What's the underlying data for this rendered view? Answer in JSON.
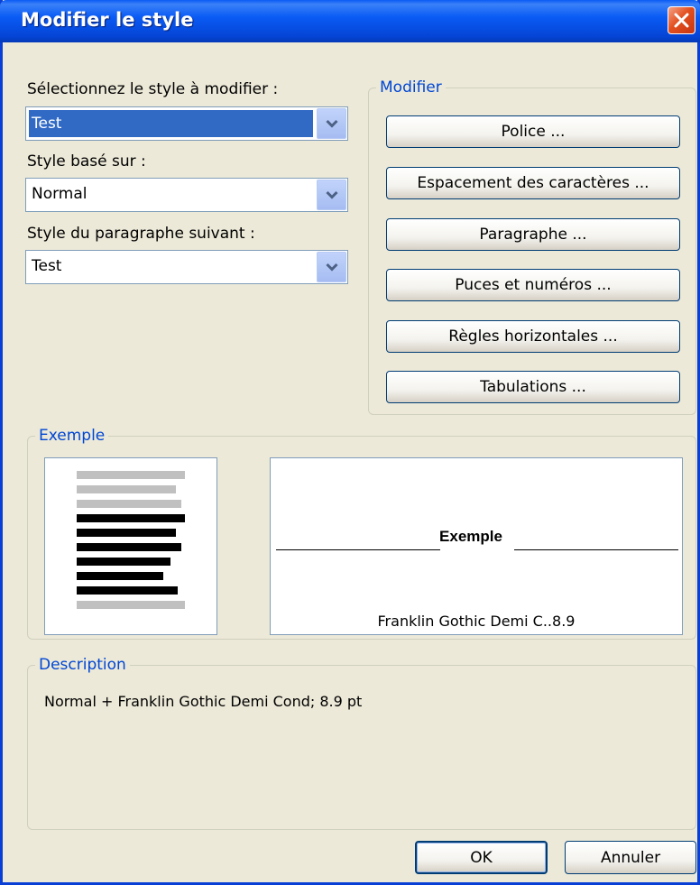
{
  "window": {
    "title": "Modifier le style"
  },
  "left": {
    "style_label": "Sélectionnez le style à modifier :",
    "style_value": "Test",
    "based_on_label": "Style basé sur :",
    "based_on_value": "Normal",
    "next_label": "Style du paragraphe suivant :",
    "next_value": "Test"
  },
  "modify": {
    "legend": "Modifier",
    "buttons": [
      "Police ...",
      "Espacement des caractères ...",
      "Paragraphe ...",
      "Puces et numéros ...",
      "Règles horizontales ...",
      "Tabulations ..."
    ]
  },
  "example": {
    "legend": "Exemple",
    "sample_text": "Exemple",
    "font_caption": "Franklin Gothic Demi C..8.9"
  },
  "description": {
    "legend": "Description",
    "text": "Normal +  Franklin Gothic Demi Cond; 8.9 pt"
  },
  "footer": {
    "ok": "OK",
    "cancel": "Annuler"
  },
  "colors": {
    "accent": "#0046D5",
    "selection": "#316AC5",
    "title_bar": "#0A5BF5",
    "close": "#E3501F"
  },
  "icons": {
    "close": "close-icon",
    "dropdown": "chevron-down-icon"
  }
}
